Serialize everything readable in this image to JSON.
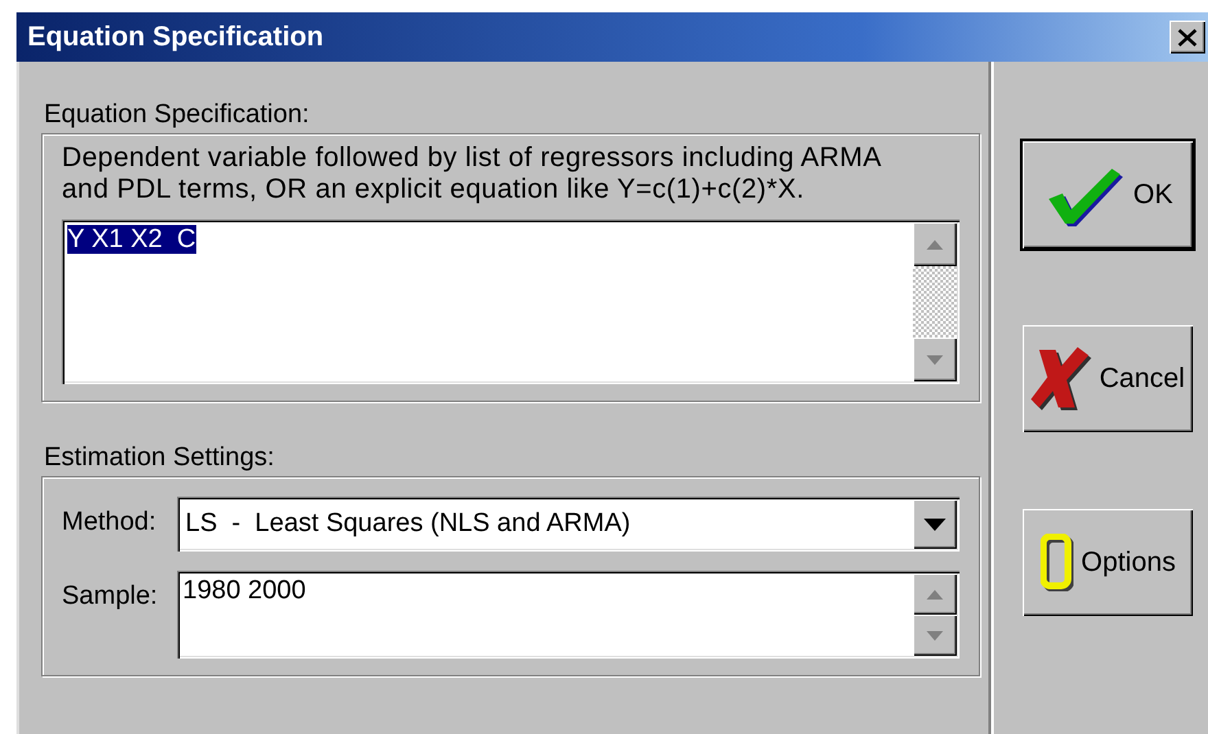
{
  "window": {
    "title": "Equation Specification"
  },
  "equation_specification": {
    "label": "Equation Specification:",
    "description": "Dependent variable followed by list of regressors including ARMA and PDL terms, OR an explicit equation like Y=c(1)+c(2)*X.",
    "value": "Y X1 X2  C",
    "selected": true
  },
  "estimation_settings": {
    "label": "Estimation Settings:",
    "method": {
      "label": "Method:",
      "value": "LS  -  Least Squares (NLS and ARMA)"
    },
    "sample": {
      "label": "Sample:",
      "value": "1980 2000"
    }
  },
  "buttons": [
    {
      "kind": "ok",
      "label": "OK",
      "default": true
    },
    {
      "kind": "cancel",
      "label": "Cancel",
      "default": false
    },
    {
      "kind": "options",
      "label": "Options",
      "default": false
    }
  ]
}
